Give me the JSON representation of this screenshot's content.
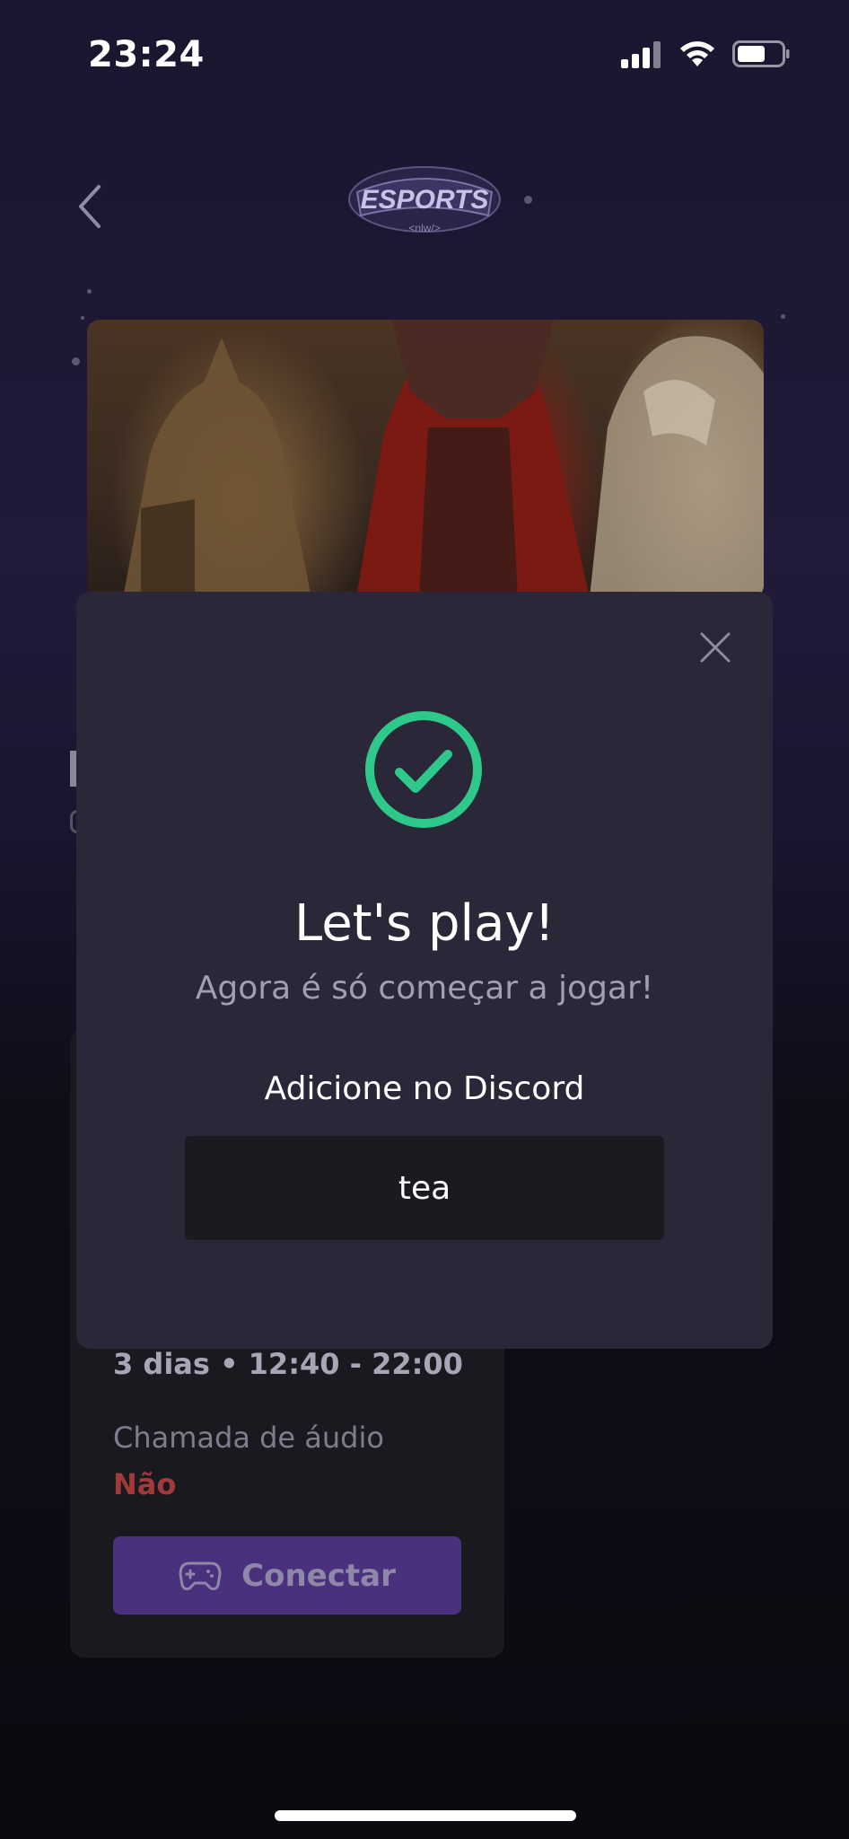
{
  "status_bar": {
    "time": "23:24"
  },
  "header": {
    "logo_text": "ESPORTS",
    "logo_subtext": "<nlw/>"
  },
  "duo_card": {
    "days_hours": "3 dias • 12:40 - 22:00",
    "audio_label": "Chamada de áudio",
    "audio_value": "Não",
    "connect_label": "Conectar"
  },
  "modal": {
    "title": "Let's play!",
    "subtitle": "Agora é só começar a jogar!",
    "discord_label": "Adicione no Discord",
    "discord_value": "tea"
  },
  "colors": {
    "success": "#2ec98a",
    "danger": "#a23a3a",
    "accent": "#4a317e",
    "modal_bg": "#2a2738"
  }
}
